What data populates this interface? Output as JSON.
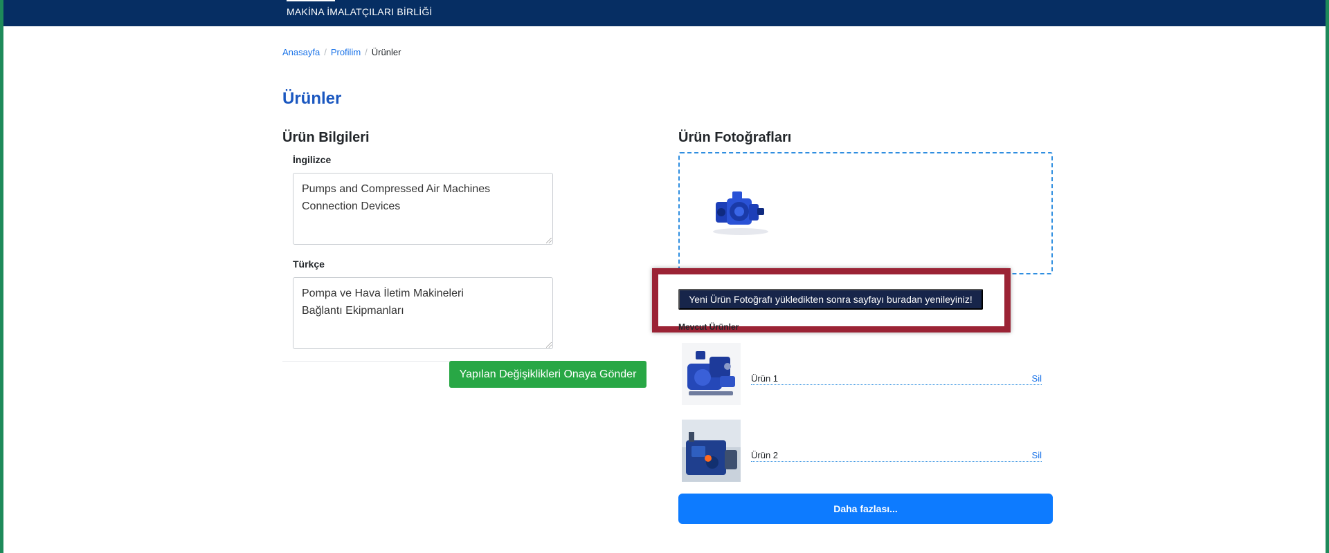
{
  "header": {
    "brand_text": "MAKİNA İMALATÇILARI BİRLİĞİ",
    "background_color": "#062e63"
  },
  "breadcrumb": {
    "items": [
      {
        "label": "Anasayfa"
      },
      {
        "label": "Profilim"
      },
      {
        "label": "Ürünler"
      }
    ],
    "separator": "/"
  },
  "page": {
    "title": "Ürünler"
  },
  "product_info": {
    "section_title": "Ürün Bilgileri",
    "english_label": "İngilizce",
    "english_value": "Pumps and Compressed Air Machines\nConnection Devices",
    "turkish_label": "Türkçe",
    "turkish_value": "Pompa ve Hava İletim Makineleri\nBağlantı Ekipmanları",
    "submit_label": "Yapılan Değişiklikleri Onaya Gönder"
  },
  "product_photos": {
    "section_title": "Ürün Fotoğrafları",
    "refresh_label": "Yeni Ürün Fotoğrafı yükledikten sonra sayfayı buradan yenileyiniz!",
    "existing_label": "Mevcut Ürünler",
    "items": [
      {
        "name": "Ürün 1",
        "delete_label": "Sil"
      },
      {
        "name": "Ürün 2",
        "delete_label": "Sil"
      }
    ],
    "more_label": "Daha fazlası..."
  },
  "colors": {
    "accent_blue": "#1a73e8",
    "submit_green": "#28a745",
    "highlight_red": "#9b2335",
    "more_button": "#0d7bff"
  }
}
